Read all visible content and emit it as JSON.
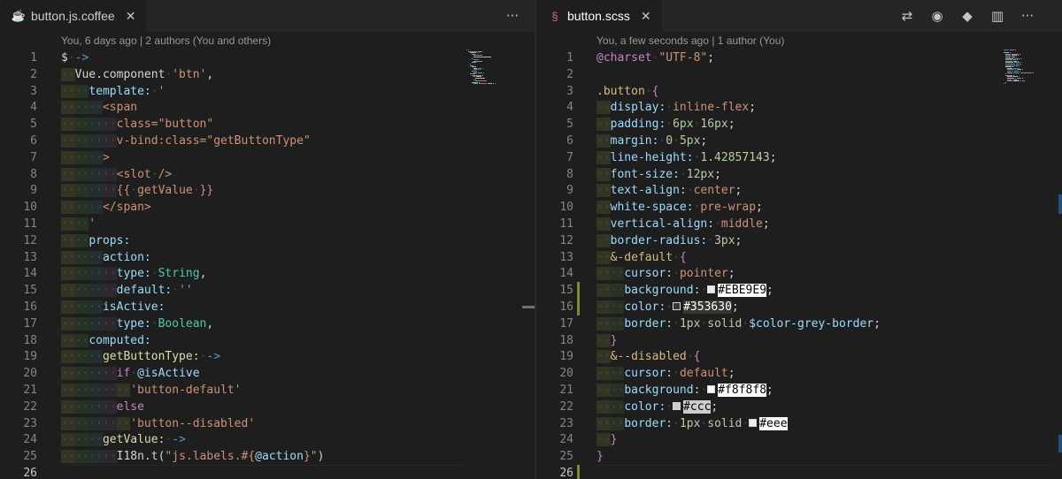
{
  "left": {
    "tab": {
      "title": "button.js.coffee",
      "close": "✕",
      "icon": "coffee-icon"
    },
    "more_actions": "···",
    "blame": "You, 6 days ago | 2 authors (You and others)",
    "active_line": 26,
    "lines": [
      {
        "n": 1,
        "d": 0,
        "t": [
          [
            "$ ",
            "sym"
          ],
          [
            "->",
            "arrow"
          ]
        ]
      },
      {
        "n": 2,
        "d": 1,
        "t": [
          [
            "Vue.component ",
            "sym"
          ],
          [
            "'btn'",
            "str"
          ],
          [
            ",",
            "sym"
          ]
        ]
      },
      {
        "n": 3,
        "d": 2,
        "t": [
          [
            "template: ",
            "prop"
          ],
          [
            "'",
            "str"
          ]
        ]
      },
      {
        "n": 4,
        "d": 3,
        "t": [
          [
            "<span",
            "str"
          ]
        ]
      },
      {
        "n": 5,
        "d": 4,
        "t": [
          [
            "class=\"button\"",
            "str"
          ]
        ]
      },
      {
        "n": 6,
        "d": 4,
        "t": [
          [
            "v-bind:class=\"getButtonType\"",
            "str"
          ]
        ]
      },
      {
        "n": 7,
        "d": 3,
        "t": [
          [
            ">",
            "str"
          ]
        ]
      },
      {
        "n": 8,
        "d": 4,
        "t": [
          [
            "<slot />",
            "str"
          ]
        ]
      },
      {
        "n": 9,
        "d": 4,
        "t": [
          [
            "{{ getValue }}",
            "str"
          ]
        ]
      },
      {
        "n": 10,
        "d": 3,
        "t": [
          [
            "</span>",
            "str"
          ]
        ]
      },
      {
        "n": 11,
        "d": 2,
        "t": [
          [
            "'",
            "str"
          ]
        ]
      },
      {
        "n": 12,
        "d": 2,
        "t": [
          [
            "props:",
            "prop"
          ]
        ]
      },
      {
        "n": 13,
        "d": 3,
        "t": [
          [
            "action:",
            "prop"
          ]
        ]
      },
      {
        "n": 14,
        "d": 4,
        "t": [
          [
            "type: ",
            "prop"
          ],
          [
            "String",
            "type"
          ],
          [
            ",",
            "sym"
          ]
        ]
      },
      {
        "n": 15,
        "d": 4,
        "t": [
          [
            "default: ",
            "prop"
          ],
          [
            "''",
            "str"
          ]
        ]
      },
      {
        "n": 16,
        "d": 3,
        "t": [
          [
            "isActive:",
            "prop"
          ]
        ]
      },
      {
        "n": 17,
        "d": 4,
        "t": [
          [
            "type: ",
            "prop"
          ],
          [
            "Boolean",
            "type"
          ],
          [
            ",",
            "sym"
          ]
        ]
      },
      {
        "n": 18,
        "d": 2,
        "t": [
          [
            "computed:",
            "prop"
          ]
        ]
      },
      {
        "n": 19,
        "d": 3,
        "t": [
          [
            "getButtonType: ",
            "fn"
          ],
          [
            "->",
            "arrow"
          ]
        ]
      },
      {
        "n": 20,
        "d": 4,
        "t": [
          [
            "if ",
            "kw"
          ],
          [
            "@isActive",
            "var"
          ]
        ]
      },
      {
        "n": 21,
        "d": 5,
        "t": [
          [
            "'button-default'",
            "str"
          ]
        ]
      },
      {
        "n": 22,
        "d": 4,
        "t": [
          [
            "else",
            "kw"
          ]
        ]
      },
      {
        "n": 23,
        "d": 5,
        "t": [
          [
            "'button--disabled'",
            "str"
          ]
        ]
      },
      {
        "n": 24,
        "d": 3,
        "t": [
          [
            "getValue: ",
            "fn"
          ],
          [
            "->",
            "arrow"
          ]
        ]
      },
      {
        "n": 25,
        "d": 4,
        "t": [
          [
            "I18n.t(",
            "sym"
          ],
          [
            "\"js.labels.#{",
            "str"
          ],
          [
            "@action",
            "var"
          ],
          [
            "}\"",
            "str"
          ],
          [
            ")",
            "sym"
          ]
        ]
      },
      {
        "n": 26,
        "d": 0,
        "t": []
      }
    ]
  },
  "right": {
    "tab": {
      "title": "button.scss",
      "close": "✕",
      "icon": "sass-icon"
    },
    "blame": "You, a few seconds ago | 1 author (You)",
    "active_line": 26,
    "modified_lines": [
      15,
      16
    ],
    "modified_line_end": 26,
    "actions": [
      {
        "name": "compare-changes-icon",
        "glyph": "⇄"
      },
      {
        "name": "open-changes-icon",
        "glyph": "◉"
      },
      {
        "name": "git-icon",
        "glyph": "◆"
      },
      {
        "name": "split-editor-icon",
        "glyph": "▥"
      },
      {
        "name": "more-actions-icon",
        "glyph": "···"
      }
    ],
    "colors": {
      "ebe9e9": "#EBE9E9",
      "dark": "#353630",
      "f8": "#f8f8f8",
      "ccc": "#cccccc",
      "eee": "#eeeeee"
    },
    "lines": [
      {
        "n": 1,
        "d": 0,
        "t": [
          [
            "@charset ",
            "at"
          ],
          [
            "\"UTF-8\"",
            "str"
          ],
          [
            ";",
            "sym"
          ]
        ]
      },
      {
        "n": 2,
        "d": 0,
        "t": []
      },
      {
        "n": 3,
        "d": 0,
        "t": [
          [
            ".button ",
            "sel"
          ],
          [
            "{",
            "kw"
          ]
        ]
      },
      {
        "n": 4,
        "d": 1,
        "t": [
          [
            "display: ",
            "prop"
          ],
          [
            "inline-flex",
            "str"
          ],
          [
            ";",
            "sym"
          ]
        ]
      },
      {
        "n": 5,
        "d": 1,
        "t": [
          [
            "padding: ",
            "prop"
          ],
          [
            "6px 16px",
            "num"
          ],
          [
            ";",
            "sym"
          ]
        ]
      },
      {
        "n": 6,
        "d": 1,
        "t": [
          [
            "margin: ",
            "prop"
          ],
          [
            "0 5px",
            "num"
          ],
          [
            ";",
            "sym"
          ]
        ]
      },
      {
        "n": 7,
        "d": 1,
        "t": [
          [
            "line-height: ",
            "prop"
          ],
          [
            "1.42857143",
            "num"
          ],
          [
            ";",
            "sym"
          ]
        ]
      },
      {
        "n": 8,
        "d": 1,
        "t": [
          [
            "font-size: ",
            "prop"
          ],
          [
            "12px",
            "num"
          ],
          [
            ";",
            "sym"
          ]
        ]
      },
      {
        "n": 9,
        "d": 1,
        "t": [
          [
            "text-align: ",
            "prop"
          ],
          [
            "center",
            "str"
          ],
          [
            ";",
            "sym"
          ]
        ]
      },
      {
        "n": 10,
        "d": 1,
        "t": [
          [
            "white-space: ",
            "prop"
          ],
          [
            "pre-wrap",
            "str"
          ],
          [
            ";",
            "sym"
          ]
        ]
      },
      {
        "n": 11,
        "d": 1,
        "t": [
          [
            "vertical-align: ",
            "prop"
          ],
          [
            "middle",
            "str"
          ],
          [
            ";",
            "sym"
          ]
        ]
      },
      {
        "n": 12,
        "d": 1,
        "t": [
          [
            "border-radius: ",
            "prop"
          ],
          [
            "3px",
            "num"
          ],
          [
            ";",
            "sym"
          ]
        ]
      },
      {
        "n": 13,
        "d": 1,
        "t": [
          [
            "&-default ",
            "sel"
          ],
          [
            "{",
            "kw"
          ]
        ]
      },
      {
        "n": 14,
        "d": 2,
        "t": [
          [
            "cursor: ",
            "prop"
          ],
          [
            "pointer",
            "str"
          ],
          [
            ";",
            "sym"
          ]
        ]
      },
      {
        "n": 15,
        "d": 2,
        "t": [
          [
            "background: ",
            "prop"
          ],
          [
            "",
            "swatch:ebe9e9"
          ],
          [
            "#EBE9E9",
            "hex"
          ],
          [
            ";",
            "sym"
          ]
        ]
      },
      {
        "n": 16,
        "d": 2,
        "t": [
          [
            "color: ",
            "prop"
          ],
          [
            "",
            "swatch:dark"
          ],
          [
            "#353630",
            "hexdark"
          ],
          [
            ";",
            "sym"
          ]
        ]
      },
      {
        "n": 17,
        "d": 2,
        "t": [
          [
            "border: ",
            "prop"
          ],
          [
            "1px solid ",
            "num"
          ],
          [
            "$color-grey-border",
            "var"
          ],
          [
            ";",
            "sym"
          ]
        ]
      },
      {
        "n": 18,
        "d": 1,
        "t": [
          [
            "}",
            "kw"
          ]
        ]
      },
      {
        "n": 19,
        "d": 1,
        "t": [
          [
            "&--disabled ",
            "sel"
          ],
          [
            "{",
            "kw"
          ]
        ]
      },
      {
        "n": 20,
        "d": 2,
        "t": [
          [
            "cursor: ",
            "prop"
          ],
          [
            "default",
            "str"
          ],
          [
            ";",
            "sym"
          ]
        ]
      },
      {
        "n": 21,
        "d": 2,
        "t": [
          [
            "background: ",
            "prop"
          ],
          [
            "",
            "swatch:f8"
          ],
          [
            "#f8f8f8",
            "hex"
          ],
          [
            ";",
            "sym"
          ]
        ]
      },
      {
        "n": 22,
        "d": 2,
        "t": [
          [
            "color: ",
            "prop"
          ],
          [
            "",
            "swatch:ccc"
          ],
          [
            "#ccc",
            "hexgrey"
          ],
          [
            ";",
            "sym"
          ]
        ]
      },
      {
        "n": 23,
        "d": 2,
        "t": [
          [
            "border: ",
            "prop"
          ],
          [
            "1px solid ",
            "num"
          ],
          [
            "",
            "swatch:eee"
          ],
          [
            "#eee",
            "hex"
          ]
        ]
      },
      {
        "n": 24,
        "d": 1,
        "t": [
          [
            "}",
            "kw"
          ]
        ]
      },
      {
        "n": 25,
        "d": 0,
        "t": [
          [
            "}",
            "kw"
          ]
        ]
      },
      {
        "n": 26,
        "d": 0,
        "t": []
      }
    ]
  }
}
